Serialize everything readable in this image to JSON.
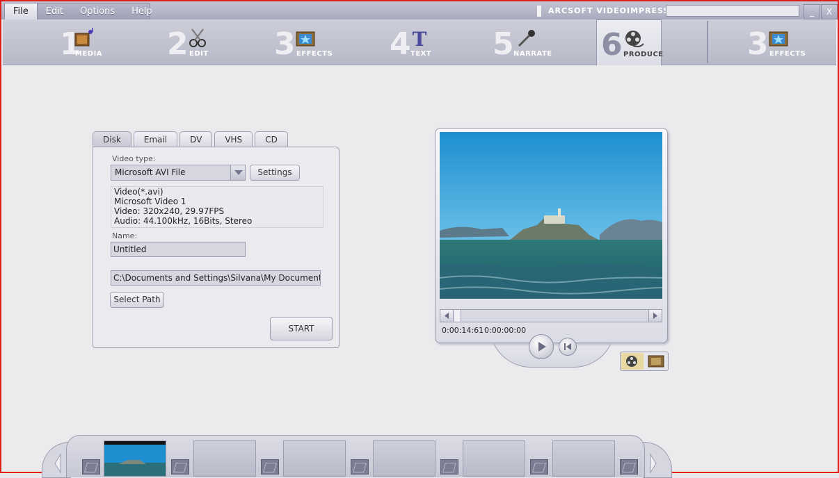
{
  "menu": [
    "File",
    "Edit",
    "Options",
    "Help"
  ],
  "brand": "ARCSOFT VIDEOIMPRESSION",
  "window_buttons": [
    "_",
    "X"
  ],
  "steps": [
    {
      "num": "1",
      "label": "MEDIA"
    },
    {
      "num": "2",
      "label": "EDIT"
    },
    {
      "num": "3",
      "label": "EFFECTS"
    },
    {
      "num": "4",
      "label": "TEXT"
    },
    {
      "num": "5",
      "label": "NARRATE"
    },
    {
      "num": "6",
      "label": "PRODUCE"
    },
    {
      "num": "3",
      "label": "EFFECTS"
    }
  ],
  "tabs": [
    "Disk",
    "Email",
    "DV",
    "VHS",
    "CD"
  ],
  "form": {
    "video_type_label": "Video type:",
    "video_type_value": "Microsoft AVI File",
    "settings_button": "Settings",
    "info_lines": [
      "Video(*.avi)",
      "Microsoft Video 1",
      "Video: 320x240, 29.97FPS",
      "Audio: 44.100kHz, 16Bits, Stereo"
    ],
    "name_label": "Name:",
    "name_value": "Untitled",
    "path_value": "C:\\Documents and Settings\\Silvana\\My Documents\\My",
    "select_path_button": "Select Path",
    "start_button": "START"
  },
  "preview": {
    "timecode_current": "0:00:14:61",
    "timecode_total": "0:00:00:00"
  }
}
